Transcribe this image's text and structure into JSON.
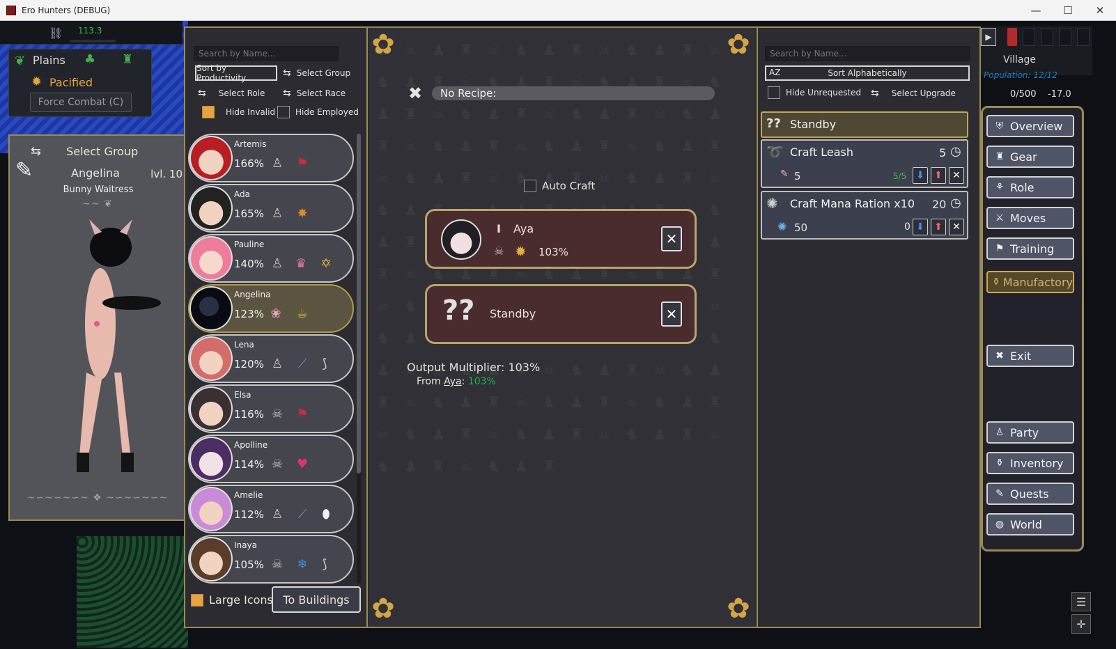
{
  "window": {
    "title": "Ero Hunters (DEBUG)",
    "minimize": "—",
    "maximize": "☐",
    "close": "✕"
  },
  "hud": {
    "resource_value": "113.3"
  },
  "region": {
    "name": "Plains",
    "status": "Pacified",
    "force_combat": "Force Combat (C)"
  },
  "character": {
    "select_group": "Select Group",
    "name": "Angelina",
    "level": "lvl. 10",
    "title": "Bunny Waitress"
  },
  "left_list": {
    "search_placeholder": "Search by Name...",
    "sort_button": "Sort by Productivity",
    "select_group": "Select Group",
    "select_role": "Select Role",
    "select_race": "Select Race",
    "hide_invalid": "Hide Invalid",
    "hide_employed": "Hide Employed",
    "large_icons": "Large Icons",
    "to_buildings": "To Buildings",
    "workers": [
      {
        "name": "Artemis",
        "pct": "166%"
      },
      {
        "name": "Ada",
        "pct": "165%"
      },
      {
        "name": "Pauline",
        "pct": "140%"
      },
      {
        "name": "Angelina",
        "pct": "123%"
      },
      {
        "name": "Lena",
        "pct": "120%"
      },
      {
        "name": "Elsa",
        "pct": "116%"
      },
      {
        "name": "Apolline",
        "pct": "114%"
      },
      {
        "name": "Amelie",
        "pct": "112%"
      },
      {
        "name": "Inaya",
        "pct": "105%"
      }
    ]
  },
  "crafting": {
    "recipe": "No Recipe:",
    "auto_craft": "Auto Craft",
    "assigned_worker": {
      "rank": "I",
      "name": "Aya",
      "pct": "103%"
    },
    "standby_slot": "Standby",
    "output_multiplier": "Output Multiplier: 103%",
    "from_label": "From",
    "from_name": "Aya",
    "from_value": "103%"
  },
  "right_list": {
    "search_placeholder": "Search by Name...",
    "sort_icon": "AZ",
    "sort_button": "Sort Alphabetically",
    "hide_unrequested": "Hide Unrequested",
    "select_upgrade": "Select Upgrade",
    "queue": [
      {
        "title": "Standby"
      },
      {
        "title": "Craft Leash",
        "time": "5",
        "amount": "5",
        "progress": "5/5"
      },
      {
        "title": "Craft Mana Ration x10",
        "time": "20",
        "amount": "50",
        "progress": "0"
      }
    ]
  },
  "side": {
    "village": "Village",
    "population": "Population: 12/12",
    "stat1": "0/500",
    "stat2": "-17.0",
    "nav": [
      {
        "label": "Overview",
        "icon": "shield-icon"
      },
      {
        "label": "Gear",
        "icon": "shirt-icon"
      },
      {
        "label": "Role",
        "icon": "role-icon"
      },
      {
        "label": "Moves",
        "icon": "swords-icon"
      },
      {
        "label": "Training",
        "icon": "training-icon"
      },
      {
        "label": "Manufactory",
        "icon": "jar-icon"
      },
      {
        "label": "Exit",
        "icon": "close-icon"
      },
      {
        "label": "Party",
        "icon": "person-icon"
      },
      {
        "label": "Inventory",
        "icon": "bag-icon"
      },
      {
        "label": "Quests",
        "icon": "quest-icon"
      },
      {
        "label": "World",
        "icon": "globe-icon"
      }
    ]
  }
}
